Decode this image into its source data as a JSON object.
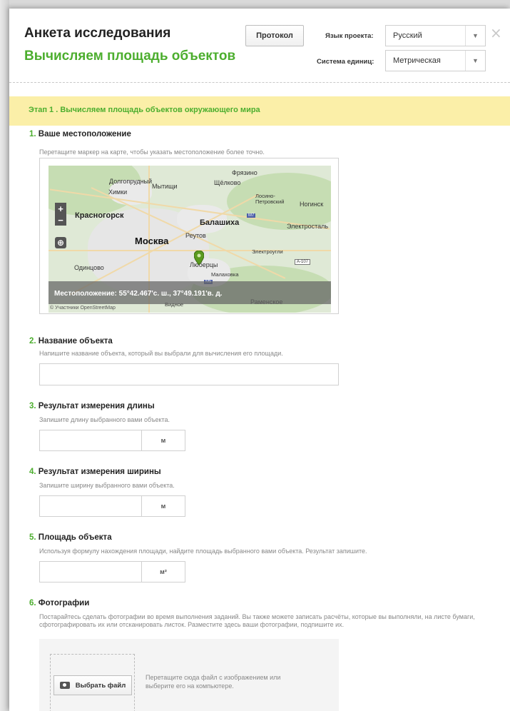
{
  "header": {
    "title": "Анкета исследования",
    "subtitle": "Вычисляем площадь объектов",
    "protocol_label": "Протокол",
    "language_label": "Язык проекта:",
    "language_value": "Русский",
    "units_label": "Система единиц:",
    "units_value": "Метрическая",
    "close_icon": "×"
  },
  "stage": {
    "title": "Этап 1 . Вычисляем площадь объектов окружающего мира"
  },
  "questions": [
    {
      "num": "1.",
      "title": "Ваше местоположение",
      "hint": "Перетащите маркер на карте, чтобы указать местоположение более точно."
    },
    {
      "num": "2.",
      "title": "Название объекта",
      "hint": "Напишите название объекта, который вы выбрали для вычисления его площади."
    },
    {
      "num": "3.",
      "title": "Результат измерения длины",
      "hint": "Запишите длину выбранного вами объекта.",
      "unit": "м"
    },
    {
      "num": "4.",
      "title": "Результат измерения ширины",
      "hint": "Запишите ширину выбранного вами объекта.",
      "unit": "м"
    },
    {
      "num": "5.",
      "title": "Площадь объекта",
      "hint": "Используя формулу нахождения площади, найдите площадь выбранного вами объекта. Результат запишите.",
      "unit": "м²"
    },
    {
      "num": "6.",
      "title": "Фотографии",
      "hint": "Постарайтесь сделать фотографии во время выполнения заданий. Вы также можете записать расчёты, которые вы выполняли, на листе бумаги, сфотографировать их или отсканировать листок. Разместите здесь ваши фотографии, подпишите их."
    }
  ],
  "map": {
    "labels": {
      "fryazino": "Фрязино",
      "dolgoprudny": "Долгопрудный",
      "mytishchi": "Мытищи",
      "shchyolkovo": "Щёлково",
      "khimki": "Химки",
      "losino": "Лосино-\nПетровский",
      "noginsk": "Ногинск",
      "krasnogorsk": "Красногорск",
      "balashikha": "Балашиха",
      "elektrostal": "Электросталь",
      "reutov": "Реутов",
      "moskva": "Москва",
      "elektrougli": "Электроугли",
      "odintsovo": "Одинцово",
      "lyubertsy": "Люберцы",
      "malakhovka": "Малаховка",
      "ramenskoe": "Раменское",
      "vidnoe": "Видное",
      "m7": "M7",
      "a107": "A-107",
      "m5": "M5"
    },
    "zoom_in": "+",
    "zoom_out": "−",
    "location_text": "Местоположение: 55°42.467'с. ш., 37°49.191'в. д.",
    "attribution": "© Участники OpenStreetMap"
  },
  "upload": {
    "button_label": "Выбрать файл",
    "drop_text": "Перетащите сюда файл с изображением или выберите его на компьютере."
  }
}
